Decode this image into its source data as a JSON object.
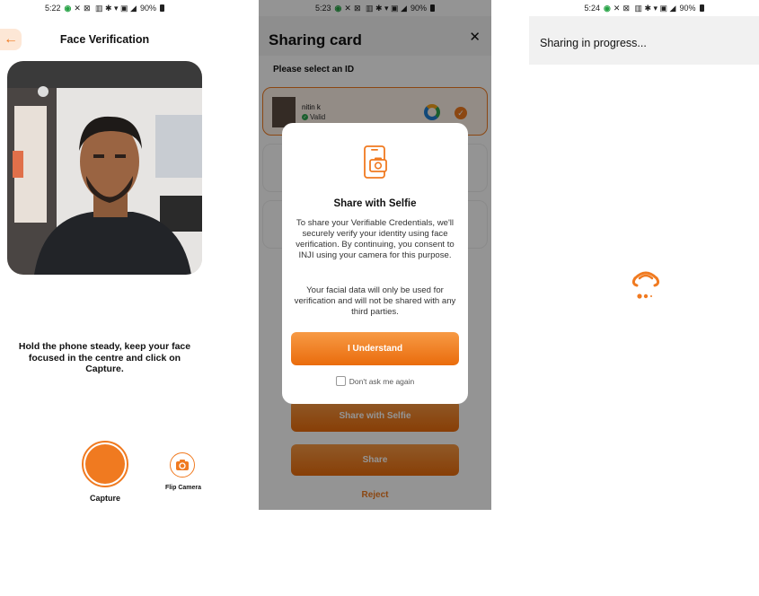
{
  "screen1": {
    "status": {
      "time": "5:22",
      "battery": "90%"
    },
    "title": "Face Verification",
    "instruction": "Hold the phone steady, keep your face focused in the centre and click on Capture.",
    "capture_label": "Capture",
    "flip_label": "Flip Camera",
    "icons": {
      "back": "arrow-left-icon",
      "flip": "flip-camera-icon"
    }
  },
  "screen2": {
    "status": {
      "time": "5:23",
      "battery": "90%"
    },
    "title": "Sharing card",
    "close_glyph": "✕",
    "subtitle": "Please select an ID",
    "cards": [
      {
        "name": "nitin k",
        "status": "Valid",
        "selected": true
      }
    ],
    "buttons": {
      "share_with_selfie": "Share with Selfie",
      "share": "Share",
      "reject": "Reject"
    },
    "modal": {
      "title": "Share with Selfie",
      "body": "To share your Verifiable Credentials, we'll securely verify your identity using face verification. By continuing, you consent to INJI using your camera for this purpose.",
      "body2": "Your facial data will only be used for verification and will not be shared with any third parties.",
      "confirm": "I Understand",
      "dont_ask": "Don't ask me again",
      "icon": "phone-camera-icon"
    }
  },
  "screen3": {
    "status": {
      "time": "5:24",
      "battery": "90%"
    },
    "title": "Sharing in progress...",
    "icon": "inji-loader-icon"
  },
  "colors": {
    "accent": "#f07a20",
    "valid": "#2ea44f"
  }
}
